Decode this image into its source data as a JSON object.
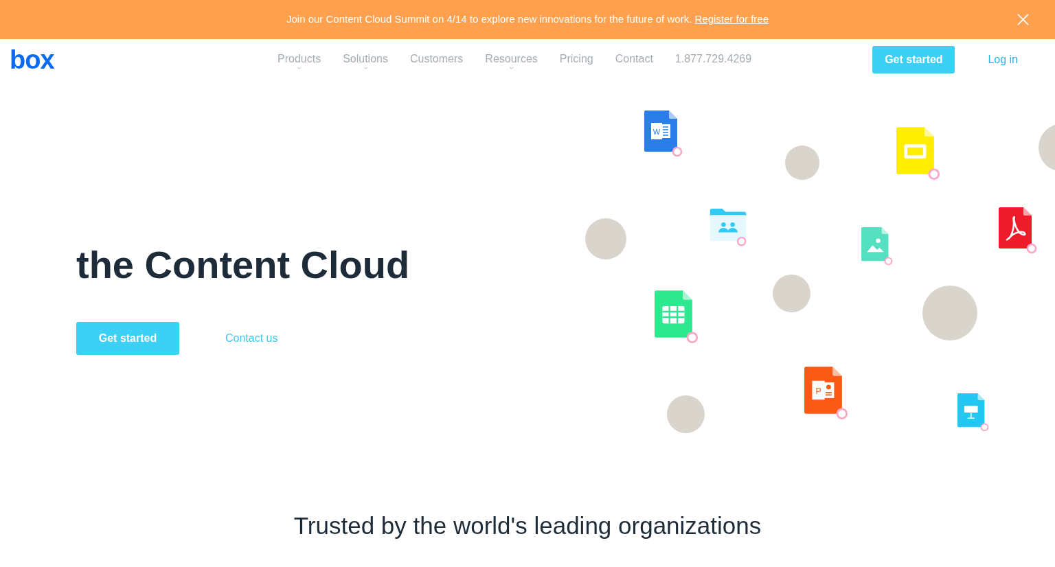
{
  "banner": {
    "text": "Join our Content Cloud Summit on 4/14 to explore new innovations for the future of work.",
    "link": "Register for free"
  },
  "header": {
    "logo": "box",
    "nav": [
      {
        "label": "Products",
        "has_menu": true
      },
      {
        "label": "Solutions",
        "has_menu": true
      },
      {
        "label": "Customers",
        "has_menu": false
      },
      {
        "label": "Resources",
        "has_menu": true
      },
      {
        "label": "Pricing",
        "has_menu": false
      },
      {
        "label": "Contact",
        "has_menu": false
      },
      {
        "label": "1.877.729.4269",
        "has_menu": false
      }
    ],
    "cta": "Get started",
    "login": "Log in"
  },
  "hero": {
    "headline": "the Content Cloud",
    "primary_button": "Get started",
    "secondary_link": "Contact us",
    "cloud": [
      {
        "kind": "word",
        "color": "#2b7de9",
        "label": "W"
      },
      {
        "kind": "avatar"
      },
      {
        "kind": "slides",
        "color": "#ffee00"
      },
      {
        "kind": "avatar"
      },
      {
        "kind": "avatar"
      },
      {
        "kind": "folder",
        "color": "#35c8f2"
      },
      {
        "kind": "image",
        "color": "#56e0c2"
      },
      {
        "kind": "pdf",
        "color": "#ee1c2a"
      },
      {
        "kind": "sheets",
        "color": "#2ee88f"
      },
      {
        "kind": "avatar"
      },
      {
        "kind": "avatar"
      },
      {
        "kind": "ppt",
        "color": "#fa5a14",
        "label": "P"
      },
      {
        "kind": "avatar"
      },
      {
        "kind": "keynote",
        "color": "#24c6f2"
      }
    ]
  },
  "trusted": {
    "title": "Trusted by the world's leading organizations"
  }
}
